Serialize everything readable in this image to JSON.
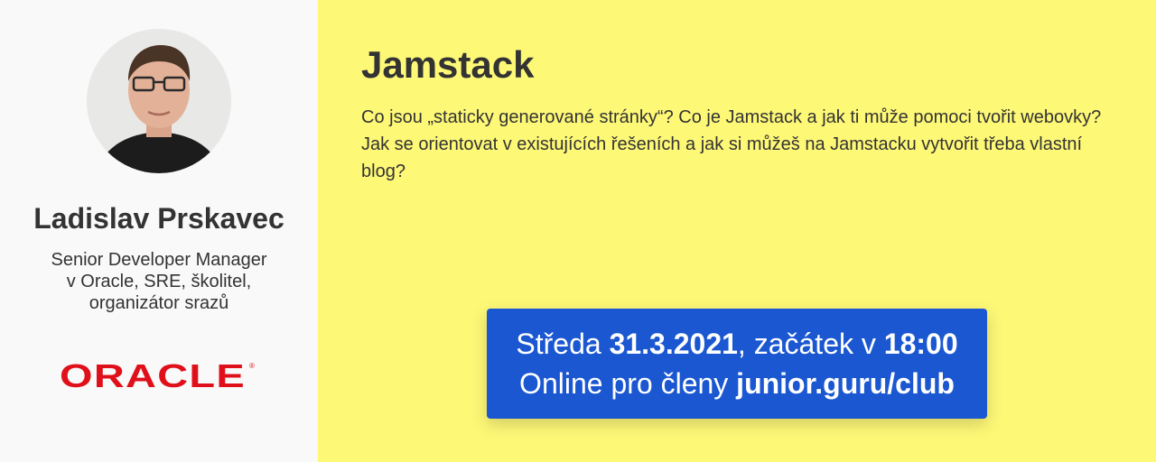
{
  "speaker": {
    "name": "Ladislav Prskavec",
    "bio_lines": [
      "Senior Developer Manager",
      "v Oracle, SRE, školitel,",
      "organizátor srazů"
    ],
    "company_logo_text": "ORACLE",
    "avatar_icon": "person-photo"
  },
  "talk": {
    "title": "Jamstack",
    "abstract": "Co jsou „staticky generované stránky“? Co je Jamstack a jak ti může pomoci tvořit webovky? Jak se orientovat v existujících řešeních a jak si můžeš na Jamstacku vytvořit třeba vlastní blog?"
  },
  "event": {
    "day_prefix": "Středa ",
    "date": "31.3.2021",
    "start_prefix": ", začátek v ",
    "time": "18:00",
    "online_prefix": "Online pro členy ",
    "club_url": "junior.guru/club"
  },
  "colors": {
    "left_bg": "#f9f9f9",
    "right_bg": "#fef877",
    "event_box": "#1a57d1",
    "oracle_red": "#e0101a"
  }
}
